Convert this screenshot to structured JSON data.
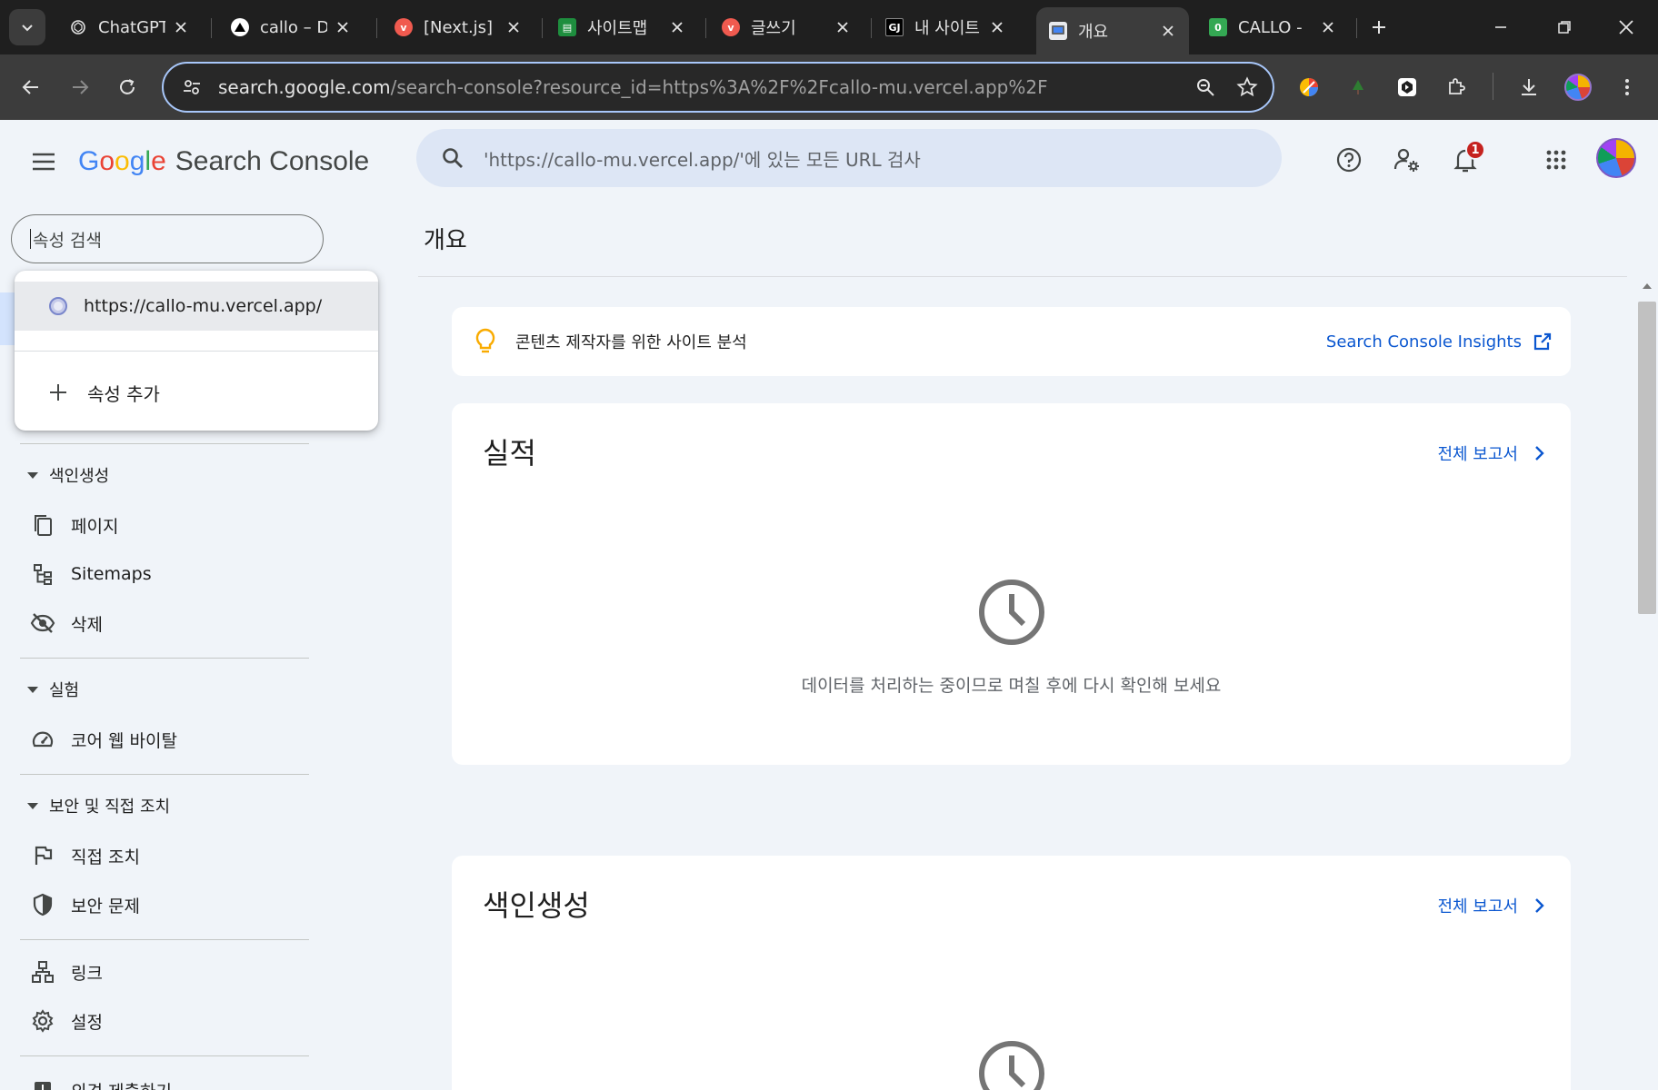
{
  "browser": {
    "tabs": [
      {
        "label": "ChatGPT",
        "favicon": "chatgpt-icon"
      },
      {
        "label": "callo – D",
        "favicon": "vercel-icon"
      },
      {
        "label": "[Next.js] ",
        "favicon": "velog-icon"
      },
      {
        "label": "사이트맵",
        "favicon": "sheets-icon"
      },
      {
        "label": "글쓰기",
        "favicon": "velog-icon"
      },
      {
        "label": "내 사이트",
        "favicon": "gj-icon"
      },
      {
        "label": "개요",
        "favicon": "search-console-icon",
        "active": true
      },
      {
        "label": "CALLO -",
        "favicon": "callo-icon"
      }
    ],
    "url_host": "search.google.com",
    "url_rest": "/search-console?resource_id=https%3A%2F%2Fcallo-mu.vercel.app%2F",
    "notification_count": "1",
    "accent_color": "#a8c7fa"
  },
  "header": {
    "brand_letters": [
      "G",
      "o",
      "o",
      "g",
      "l",
      "e"
    ],
    "product": "Search Console",
    "search_placeholder": "'https://callo-mu.vercel.app/'에 있는 모든 URL 검사",
    "notification_count": "1"
  },
  "sidebar": {
    "property_search_placeholder": "속성 검색",
    "sections": [
      {
        "label": "색인생성",
        "items": [
          {
            "label": "페이지",
            "icon": "pages-icon"
          },
          {
            "label": "Sitemaps",
            "icon": "sitemap-icon"
          },
          {
            "label": "삭제",
            "icon": "visibility-off-icon"
          }
        ]
      },
      {
        "label": "실험",
        "items": [
          {
            "label": "코어 웹 바이탈",
            "icon": "speed-icon"
          }
        ]
      },
      {
        "label": "보안 및 직접 조치",
        "items": [
          {
            "label": "직접 조치",
            "icon": "flag-icon"
          },
          {
            "label": "보안 문제",
            "icon": "shield-icon"
          }
        ]
      }
    ],
    "extra_items": [
      {
        "label": "링크",
        "icon": "links-icon"
      },
      {
        "label": "설정",
        "icon": "settings-icon"
      }
    ],
    "feedback": "의견 제출하기"
  },
  "dropdown": {
    "property": "https://callo-mu.vercel.app/",
    "add_property": "속성 추가"
  },
  "main": {
    "title": "개요",
    "insights_text": "콘텐츠 제작자를 위한 사이트 분석",
    "insights_link": "Search Console Insights",
    "performance_title": "실적",
    "full_report": "전체 보고서",
    "processing_message": "데이터를 처리하는 중이므로 며칠 후에 다시 확인해 보세요",
    "indexing_title": "색인생성",
    "full_report_2": "전체 보고서"
  }
}
